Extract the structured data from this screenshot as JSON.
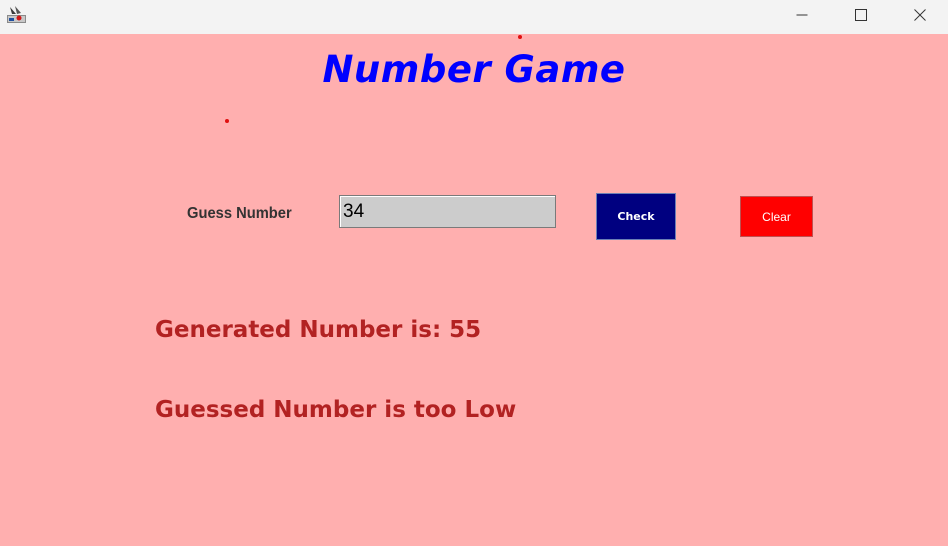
{
  "titlebar": {
    "app_icon": "java-app-icon",
    "minimize_icon": "minimize-icon",
    "maximize_icon": "maximize-icon",
    "close_icon": "close-icon"
  },
  "game": {
    "title": "Number Game",
    "guess_label": "Guess Number",
    "guess_value": "34",
    "check_label": "Check",
    "clear_label": "Clear",
    "generated_text": "Generated Number is: 55",
    "result_text": "Guessed Number is too Low"
  },
  "colors": {
    "background": "#ffafaf",
    "title": "#0000ff",
    "check_button": "#000080",
    "clear_button": "#ff0000",
    "result_text": "#b22222",
    "input_background": "#cccccc"
  }
}
